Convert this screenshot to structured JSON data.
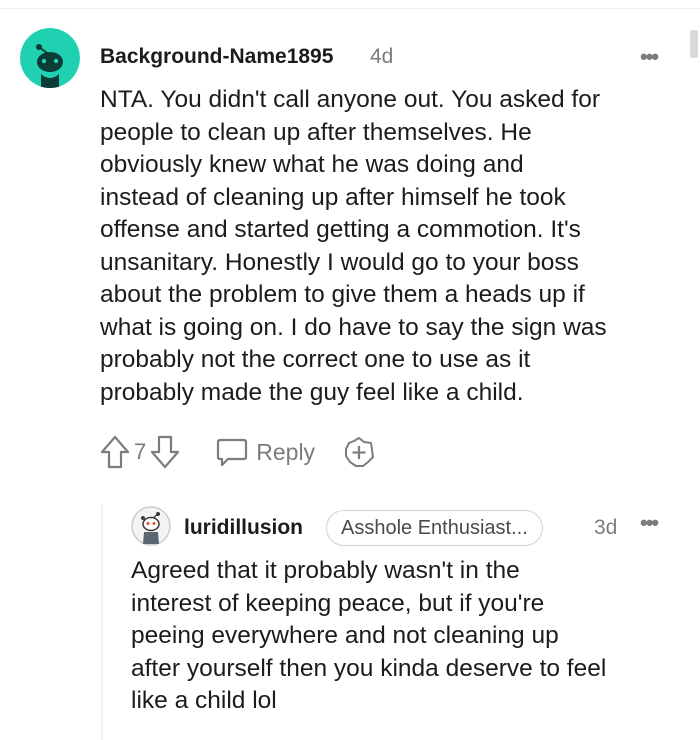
{
  "comment": {
    "username": "Background-Name1895",
    "time": "4d",
    "body_lines": [
      "NTA. You didn't call anyone out. You asked for",
      "people to clean up after themselves. He",
      "obviously knew what he was doing and",
      "instead of cleaning up after himself he took",
      "offense and started getting a commotion. It's",
      "unsanitary. Honestly I would go to your boss",
      "about the problem to give them a heads up if",
      "what is going on. I do have to say the sign was",
      "probably not the correct one to use as it",
      "probably made the guy feel like a child."
    ],
    "score": "7",
    "reply_label": "Reply",
    "avatar_color": "#1fd1b0"
  },
  "reply": {
    "username": "luridillusion",
    "flair": "Asshole Enthusiast...",
    "time": "3d",
    "body_lines": [
      "Agreed that it probably wasn't in the",
      "interest of keeping peace, but if you're",
      "peeing everywhere and not cleaning up",
      "after yourself then you kinda deserve to feel",
      "like a child lol"
    ]
  },
  "icons": {
    "more": "more-dots-icon",
    "upvote": "upvote-arrow-icon",
    "downvote": "downvote-arrow-icon",
    "reply": "speech-bubble-icon",
    "award": "plus-award-icon"
  }
}
